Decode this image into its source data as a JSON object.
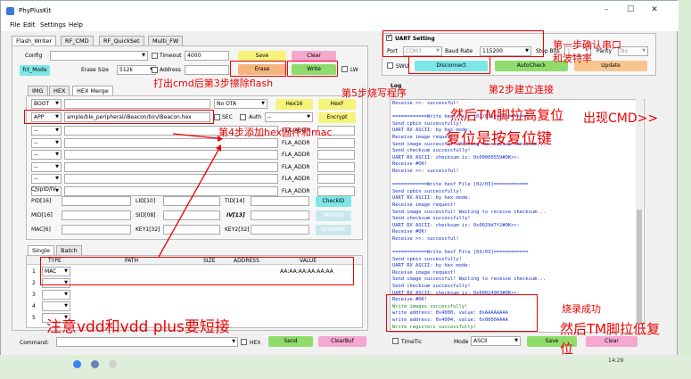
{
  "window": {
    "title": "PhyPlusKit",
    "controls": [
      "–",
      "☐",
      "✕"
    ]
  },
  "menu": [
    "File",
    "Edit",
    "Settings",
    "Help"
  ],
  "tabs": [
    "Flash_Writer",
    "RF_CMD",
    "RF_QuickSet",
    "Multi_FW"
  ],
  "config": {
    "label": "Config",
    "timeout_label": "Timeout",
    "timeout_value": "4000",
    "save": "Save",
    "clear": "Clear",
    "fct_mode": "fct_Mode",
    "erase_size_label": "Erase Size",
    "erase_size_value": "512k",
    "address_label": "Address",
    "erase": "Erase",
    "write": "Write",
    "lw": "LW"
  },
  "subtabs": [
    "IMG",
    "HEX",
    "HEX Merge"
  ],
  "boot": {
    "boot_label": "BOOT",
    "ota_value": "No OTA",
    "hex16": "Hex16",
    "hexf": "HexF",
    "app_label": "APP",
    "app_path": "ample/ble_peripheral/iBeacon/bin/iBeacon.hex",
    "sec": "SEC",
    "auth": "Auth",
    "auth_value": "--",
    "encrypt": "Encrypt",
    "fla_addr": "FLA_ADDR"
  },
  "chip": {
    "title": "ChipID/IV",
    "pid": "PID[16]",
    "lid": "LID[10]",
    "tid": "TID[14]",
    "checkid": "CheckID",
    "mid": "MID[16]",
    "sid": "SID[08]",
    "iv": "IV[13]",
    "writeid": "WriteID",
    "mac": "MAC[6]",
    "key1": "KEY1[32]",
    "key2": "KEY2[32]",
    "writemac": "WriteMAC"
  },
  "table": {
    "tabs": [
      "Single",
      "Batch"
    ],
    "headers": [
      "TYPE",
      "PATH",
      "SIZE",
      "ADDRESS",
      "VALUE"
    ],
    "rows": [
      {
        "num": "1",
        "type": "MAC",
        "value": "AA:AA:AA:AA:AA:AA"
      },
      {
        "num": "2",
        "type": "",
        "value": ""
      },
      {
        "num": "3",
        "type": "",
        "value": ""
      },
      {
        "num": "4",
        "type": "",
        "value": ""
      },
      {
        "num": "5",
        "type": "",
        "value": ""
      }
    ]
  },
  "command": {
    "label": "Command:",
    "hex": "HEX",
    "send": "Send",
    "clearbuf": "ClearBuf"
  },
  "uart": {
    "title": "UART Setting",
    "port_label": "Port",
    "port_value": "COM3",
    "baud_label": "Baud Rate",
    "baud_value": "115200",
    "stop_label": "Stop Bits",
    "stop_value": "1",
    "parity_label": "Parity",
    "parity_value": "No",
    "swu": "SWU",
    "disconnect": "Disconnect",
    "autocheck": "AutoCheck",
    "update": "Update"
  },
  "log": {
    "title": "Log",
    "lines": [
      {
        "t": "Receive >>: successful!",
        "g": false
      },
      {
        "t": "",
        "g": false
      },
      {
        "t": "============Write hexf File [01/03]============",
        "g": false
      },
      {
        "t": "Send cpbin successfully!",
        "g": false
      },
      {
        "t": "UART RX ASCII: by hex mode:",
        "g": false
      },
      {
        "t": "Receive image request!",
        "g": false
      },
      {
        "t": "Send image successful! Waiting to receive checksum...",
        "g": false
      },
      {
        "t": "Send checksum successfully!",
        "g": false
      },
      {
        "t": "UART RX ASCII: checksum is: 0x00000559#OK>>:",
        "g": false
      },
      {
        "t": "Receive #OK!",
        "g": false
      },
      {
        "t": "Receive >>: successful!",
        "g": false
      },
      {
        "t": "",
        "g": false
      },
      {
        "t": "============Write hexf File [02/03]============",
        "g": false
      },
      {
        "t": "Send cpbin successfully!",
        "g": false
      },
      {
        "t": "UART RX ASCII: by hex mode:",
        "g": false
      },
      {
        "t": "Receive image request!",
        "g": false
      },
      {
        "t": "Send image successful! Waiting to receive checksum...",
        "g": false
      },
      {
        "t": "Send checksum successfully!",
        "g": false
      },
      {
        "t": "UART RX ASCII: checksum is: 0x0029d7f2#OK>>:",
        "g": false
      },
      {
        "t": "Receive #OK!",
        "g": false
      },
      {
        "t": "Receive >>: successful!",
        "g": false
      },
      {
        "t": "",
        "g": false
      },
      {
        "t": "============Write hexf File [03/03]============",
        "g": false
      },
      {
        "t": "Send cpbin successfully!",
        "g": false
      },
      {
        "t": "UART RX ASCII: by hex mode:",
        "g": false
      },
      {
        "t": "Receive image request!",
        "g": false
      },
      {
        "t": "Send image successful! Waiting to receive checksum...",
        "g": false
      },
      {
        "t": "Send checksum successfully!",
        "g": false
      },
      {
        "t": "UART RX ASCII: checksum is: 0x00024963#OK>>:",
        "g": false
      },
      {
        "t": "Receive #OK!",
        "g": false
      },
      {
        "t": "Write images successfully!",
        "g": true
      },
      {
        "t": "write address: 0x4000, value: 0xAAAAAAAA",
        "g": false
      },
      {
        "t": "write address: 0x4004, value: 0x0000AAAA",
        "g": false
      },
      {
        "t": "Write registers successfully!",
        "g": true
      }
    ]
  },
  "bottom": {
    "timetic": "TimeTic",
    "mode_label": "Mode",
    "mode_value": "ASCII",
    "save": "Save",
    "clear": "Clear",
    "clock": "14:29"
  },
  "annotations": {
    "step1": "第一步确认串口",
    "step1b": "和波特率",
    "step2": "第2步建立连接",
    "step3": "打出cmd后第3步擦除flash",
    "step4": "第4步添加hex固件和mac",
    "step5": "第5步烧写程序",
    "reset_pull": "然后TM脚拉高复位",
    "reset_key": "复位是按复位键",
    "cmd_appear": "出现CMD>>",
    "burn_ok": "烧录成功",
    "tm_low": "然后TM脚拉低复",
    "tm_low2": "位",
    "short_note": "注意vdd和vdd plus要短接"
  },
  "colors": {
    "annotation": "#ee0000",
    "log_text": "#1530c8",
    "log_success": "#1a8a1a"
  }
}
